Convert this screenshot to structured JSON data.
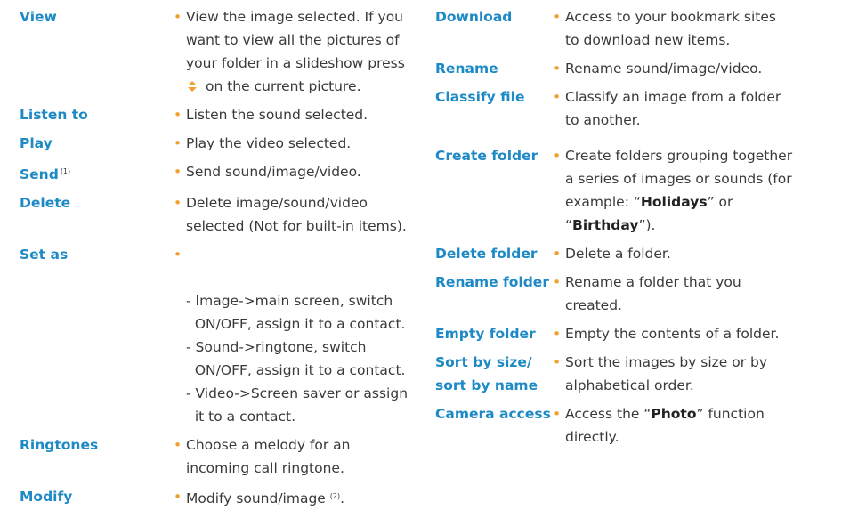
{
  "colors": {
    "term": "#1d8ac6",
    "bullet": "#f0a030",
    "text": "#3a3a3a"
  },
  "bullet": "•",
  "left": [
    {
      "term": "View",
      "lines": [
        "View the image selected. If you",
        "want to view all the pictures of",
        "your folder in a slideshow press",
        "on the current picture."
      ]
    },
    {
      "term": "Listen to",
      "lines": [
        "Listen the sound selected."
      ]
    },
    {
      "term": "Play",
      "lines": [
        "Play the video selected."
      ]
    },
    {
      "term": "Send",
      "term_note": "(1)",
      "lines": [
        "Send sound/image/video."
      ]
    },
    {
      "term": "Delete",
      "lines": [
        "Delete image/sound/video",
        "selected (Not for built-in items)."
      ]
    },
    {
      "term": "Set as",
      "lines": [
        "- Image->main screen, switch",
        "  ON/OFF, assign it to a contact.",
        "- Sound->ringtone, switch",
        "  ON/OFF, assign it to a contact.",
        "- Video->Screen saver or assign",
        "  it to a contact."
      ]
    },
    {
      "term": "Ringtones",
      "lines": [
        "Choose a melody for an",
        "incoming call ringtone."
      ]
    },
    {
      "term": "Modify",
      "lines": [
        "Modify sound/image"
      ],
      "line_note": "(2)",
      "line_end": "."
    }
  ],
  "right": [
    {
      "term": "Download",
      "lines": [
        "Access to your bookmark sites",
        "to download new items."
      ]
    },
    {
      "term": "Rename",
      "lines": [
        "Rename sound/image/video."
      ]
    },
    {
      "term": "Classify file",
      "lines": [
        "Classify an image from a folder",
        "to another."
      ]
    },
    {
      "term": "Create folder",
      "lines_pre": [
        "Create folders grouping together",
        "a series of images or sounds (for",
        "example: “"
      ],
      "bold1": "Holidays",
      "mid": "” or",
      "quote_open": "“",
      "bold2": "Birthday",
      "end": "”)."
    },
    {
      "term": "Delete folder",
      "lines": [
        "Delete a folder."
      ]
    },
    {
      "term": "Rename folder",
      "lines": [
        "Rename a folder that you",
        "created."
      ]
    },
    {
      "term": "Empty folder",
      "lines": [
        "Empty the contents of a folder."
      ]
    },
    {
      "term": "Sort by size/",
      "term2": "sort by name",
      "lines": [
        "Sort the images by size or by",
        "alphabetical order."
      ]
    },
    {
      "term": "Camera access",
      "pre": "Access the “",
      "bold": "Photo",
      "post": "” function",
      "line2": "directly."
    }
  ]
}
